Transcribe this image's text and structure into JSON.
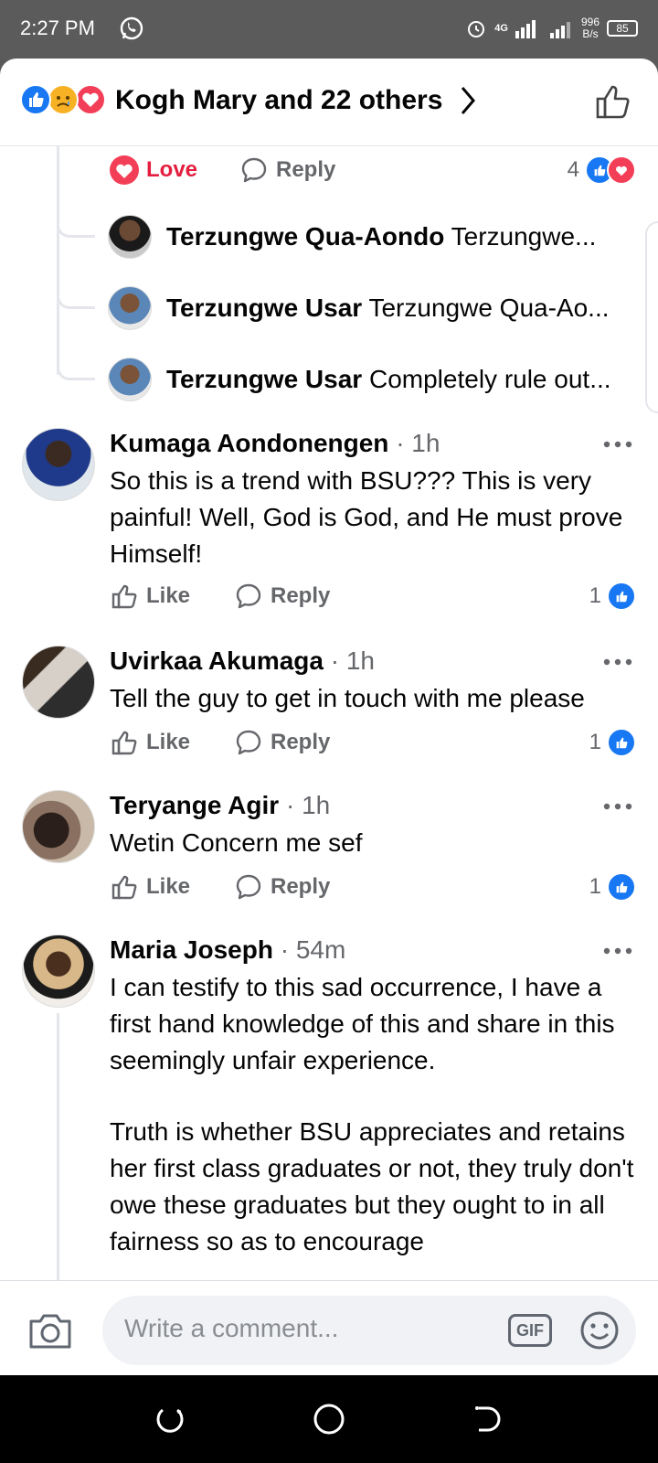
{
  "status_bar": {
    "time": "2:27 PM",
    "network": "4G",
    "speed_value": "996",
    "speed_unit": "B/s",
    "battery": "85"
  },
  "header": {
    "reactions": [
      "like-icon",
      "sad-icon",
      "love-icon"
    ],
    "title": "Kogh Mary and 22 others"
  },
  "prev_comment_actions": {
    "love_label": "Love",
    "reply_label": "Reply",
    "reaction_count": "4"
  },
  "replies": [
    {
      "name": "Terzungwe Qua-Aondo",
      "text": "Terzungwe..."
    },
    {
      "name": "Terzungwe Usar",
      "text": "Terzungwe Qua-Ao..."
    },
    {
      "name": "Terzungwe Usar",
      "text": "Completely rule out..."
    }
  ],
  "comments": [
    {
      "name": "Kumaga Aondonengen",
      "time": "1h",
      "body": "So this is a trend with BSU??? This is very painful! Well, God is God, and He must prove Himself!",
      "like_label": "Like",
      "reply_label": "Reply",
      "count": "1"
    },
    {
      "name": "Uvirkaa Akumaga",
      "time": "1h",
      "body": "Tell the guy to get in touch with me please",
      "like_label": "Like",
      "reply_label": "Reply",
      "count": "1"
    },
    {
      "name": "Teryange Agir",
      "time": "1h",
      "body": "Wetin Concern me sef",
      "like_label": "Like",
      "reply_label": "Reply",
      "count": "1"
    },
    {
      "name": "Maria Joseph",
      "time": "54m",
      "body": "I can testify to this sad occurrence, I have a first hand knowledge of this and share in this seemingly unfair experience.",
      "body2": "Truth is whether BSU appreciates and retains her first class graduates or not, they truly don't owe these graduates but they ought to in all fairness so as to encourage"
    }
  ],
  "composer": {
    "placeholder": "Write a comment...",
    "gif_label": "GIF"
  },
  "colors": {
    "accent": "#1877f2",
    "love": "#f33e58",
    "muted": "#65676b"
  }
}
